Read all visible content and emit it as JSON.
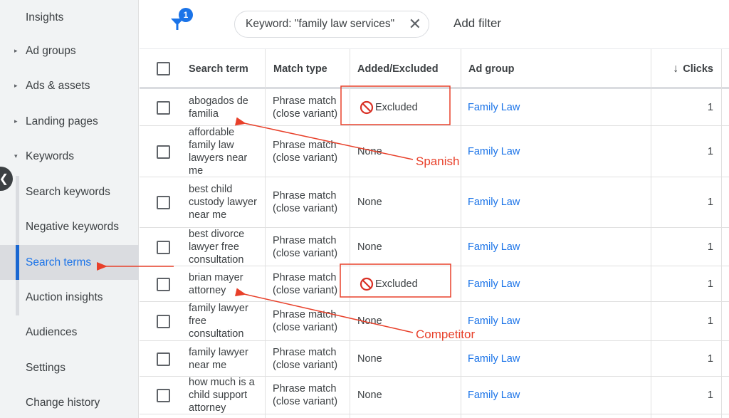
{
  "sidebar": {
    "items": [
      {
        "label": "Insights",
        "caret": ""
      },
      {
        "label": "Ad groups",
        "caret": "▸"
      },
      {
        "label": "Ads & assets",
        "caret": "▸"
      },
      {
        "label": "Landing pages",
        "caret": "▸"
      },
      {
        "label": "Keywords",
        "caret": "▾"
      },
      {
        "label": "Search keywords",
        "caret": ""
      },
      {
        "label": "Negative keywords",
        "caret": ""
      },
      {
        "label": "Search terms",
        "caret": ""
      },
      {
        "label": "Auction insights",
        "caret": ""
      },
      {
        "label": "Audiences",
        "caret": ""
      },
      {
        "label": "Settings",
        "caret": ""
      },
      {
        "label": "Change history",
        "caret": ""
      }
    ],
    "active_item": "Search terms",
    "collapse_glyph": "❮"
  },
  "filterbar": {
    "filter_count": "1",
    "chip_label": "Keyword: \"family law services\"",
    "chip_close": "✕",
    "add_filter_label": "Add filter"
  },
  "table": {
    "headers": {
      "search_term": "Search term",
      "match_type": "Match type",
      "added_excluded": "Added/Excluded",
      "ad_group": "Ad group",
      "clicks": "Clicks",
      "sort_arrow": "↓"
    },
    "rows": [
      {
        "term": "abogados de familia",
        "match": "Phrase match (close variant)",
        "status": "Excluded",
        "ad_group": "Family Law",
        "clicks": "1"
      },
      {
        "term": "affordable family law lawyers near me",
        "match": "Phrase match (close variant)",
        "status": "None",
        "ad_group": "Family Law",
        "clicks": "1"
      },
      {
        "term": "best child custody lawyer near me",
        "match": "Phrase match (close variant)",
        "status": "None",
        "ad_group": "Family Law",
        "clicks": "1"
      },
      {
        "term": "best divorce lawyer free consultation",
        "match": "Phrase match (close variant)",
        "status": "None",
        "ad_group": "Family Law",
        "clicks": "1"
      },
      {
        "term": "brian mayer attorney",
        "match": "Phrase match (close variant)",
        "status": "Excluded",
        "ad_group": "Family Law",
        "clicks": "1"
      },
      {
        "term": "family lawyer free consultation",
        "match": "Phrase match (close variant)",
        "status": "None",
        "ad_group": "Family Law",
        "clicks": "1"
      },
      {
        "term": "family lawyer near me",
        "match": "Phrase match (close variant)",
        "status": "None",
        "ad_group": "Family Law",
        "clicks": "1"
      },
      {
        "term": "how much is a child support attorney",
        "match": "Phrase match (close variant)",
        "status": "None",
        "ad_group": "Family Law",
        "clicks": "1"
      }
    ]
  },
  "annotations": {
    "spanish_label": "Spanish",
    "competitor_label": "Competitor",
    "color": "#e8402a"
  },
  "colors": {
    "accent": "#1a73e8",
    "sidebar_bg": "#f1f3f4",
    "active_bg": "#dadce0",
    "excluded_red": "#d93025"
  }
}
